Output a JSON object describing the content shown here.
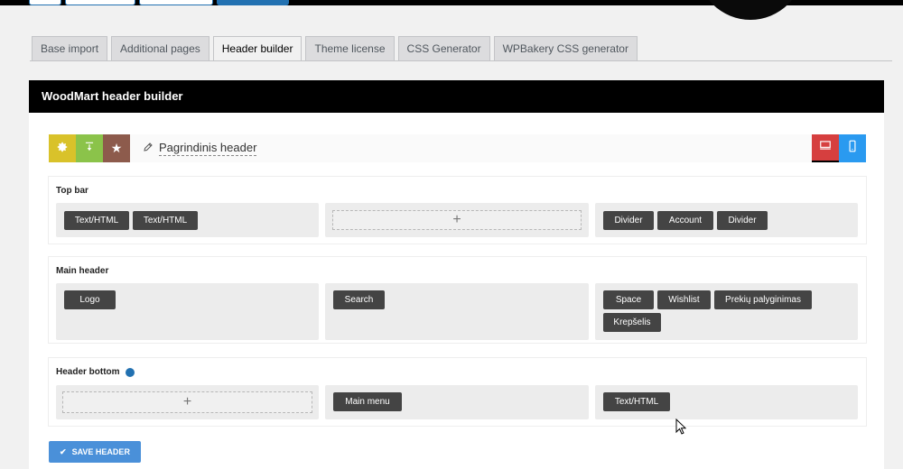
{
  "tabs": [
    {
      "label": "Base import"
    },
    {
      "label": "Additional pages"
    },
    {
      "label": "Header builder",
      "active": true
    },
    {
      "label": "Theme license"
    },
    {
      "label": "CSS Generator"
    },
    {
      "label": "WPBakery CSS generator"
    }
  ],
  "panel": {
    "title": "WoodMart header builder"
  },
  "toolbar": {
    "header_name": "Pagrindinis header",
    "colors": {
      "settings": "#d9c22a",
      "import": "#8bc34a",
      "presets": "#8d5b4c",
      "desktop": "#d63f3f",
      "mobile": "#2a9af0"
    },
    "icons": {
      "settings": "gear-icon",
      "import": "download-icon",
      "presets": "star-icon",
      "edit": "pencil-icon",
      "desktop": "desktop-icon",
      "mobile": "mobile-icon"
    }
  },
  "rows": {
    "top_bar": {
      "title": "Top bar",
      "left": [
        "Text/HTML",
        "Text/HTML"
      ],
      "center_add": "+",
      "right": [
        "Divider",
        "Account",
        "Divider"
      ]
    },
    "main_header": {
      "title": "Main header",
      "left": [
        "Logo"
      ],
      "center": [
        "Search"
      ],
      "right": [
        "Space",
        "Wishlist",
        "Prekių palyginimas",
        "Krepšelis"
      ]
    },
    "header_bottom": {
      "title": "Header bottom",
      "left_add": "+",
      "center": [
        "Main menu"
      ],
      "right": [
        "Text/HTML"
      ]
    }
  },
  "save_button": {
    "label": "SAVE HEADER",
    "icon": "check-icon"
  }
}
